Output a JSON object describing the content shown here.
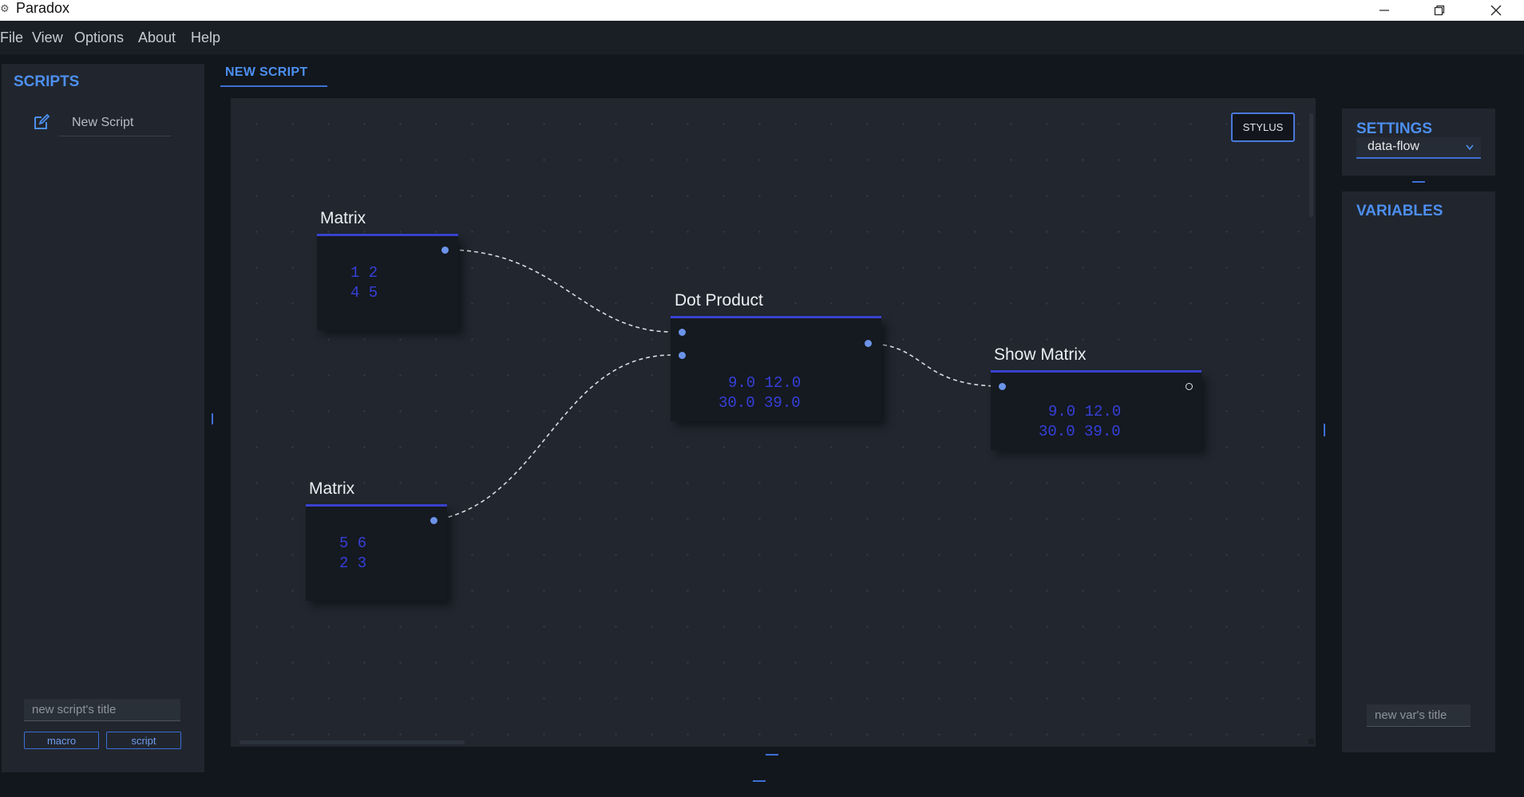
{
  "window": {
    "title": "Paradox",
    "app_icon": "gear-icon",
    "controls": [
      "minimize-icon",
      "restore-icon",
      "close-icon"
    ]
  },
  "menu": {
    "items": [
      "File",
      "View",
      "Options",
      "About",
      "Help"
    ]
  },
  "scripts_panel": {
    "title": "SCRIPTS",
    "items": [
      {
        "label": "New Script",
        "icon": "edit-icon"
      }
    ],
    "title_input_placeholder": "new script's title",
    "macro_button": "macro",
    "script_button": "script"
  },
  "editor": {
    "tab_label": "NEW SCRIPT",
    "stylus_button": "STYLUS",
    "nodes": [
      {
        "id": "matrix1",
        "title": "Matrix",
        "rows": [
          "1 2",
          "4 5"
        ]
      },
      {
        "id": "matrix2",
        "title": "Matrix",
        "rows": [
          "5 6",
          "2 3"
        ]
      },
      {
        "id": "dot",
        "title": "Dot Product",
        "rows": [
          "9.0 12.0",
          "30.0 39.0"
        ]
      },
      {
        "id": "show",
        "title": "Show Matrix",
        "rows": [
          "9.0 12.0",
          "30.0 39.0"
        ]
      }
    ],
    "connections": [
      {
        "from": "matrix1",
        "to": "dot",
        "to_port": 1
      },
      {
        "from": "matrix2",
        "to": "dot",
        "to_port": 2
      },
      {
        "from": "dot",
        "to": "show",
        "to_port": 1
      }
    ]
  },
  "settings_panel": {
    "title": "SETTINGS",
    "flow_mode": "data-flow"
  },
  "variables_panel": {
    "title": "VARIABLES",
    "title_input_placeholder": "new var's title"
  },
  "colors": {
    "accent": "#4d8ff0",
    "node_value": "#3540d8",
    "node_line": "#3a44d4",
    "background": "#12171d",
    "panel": "#21262e"
  }
}
